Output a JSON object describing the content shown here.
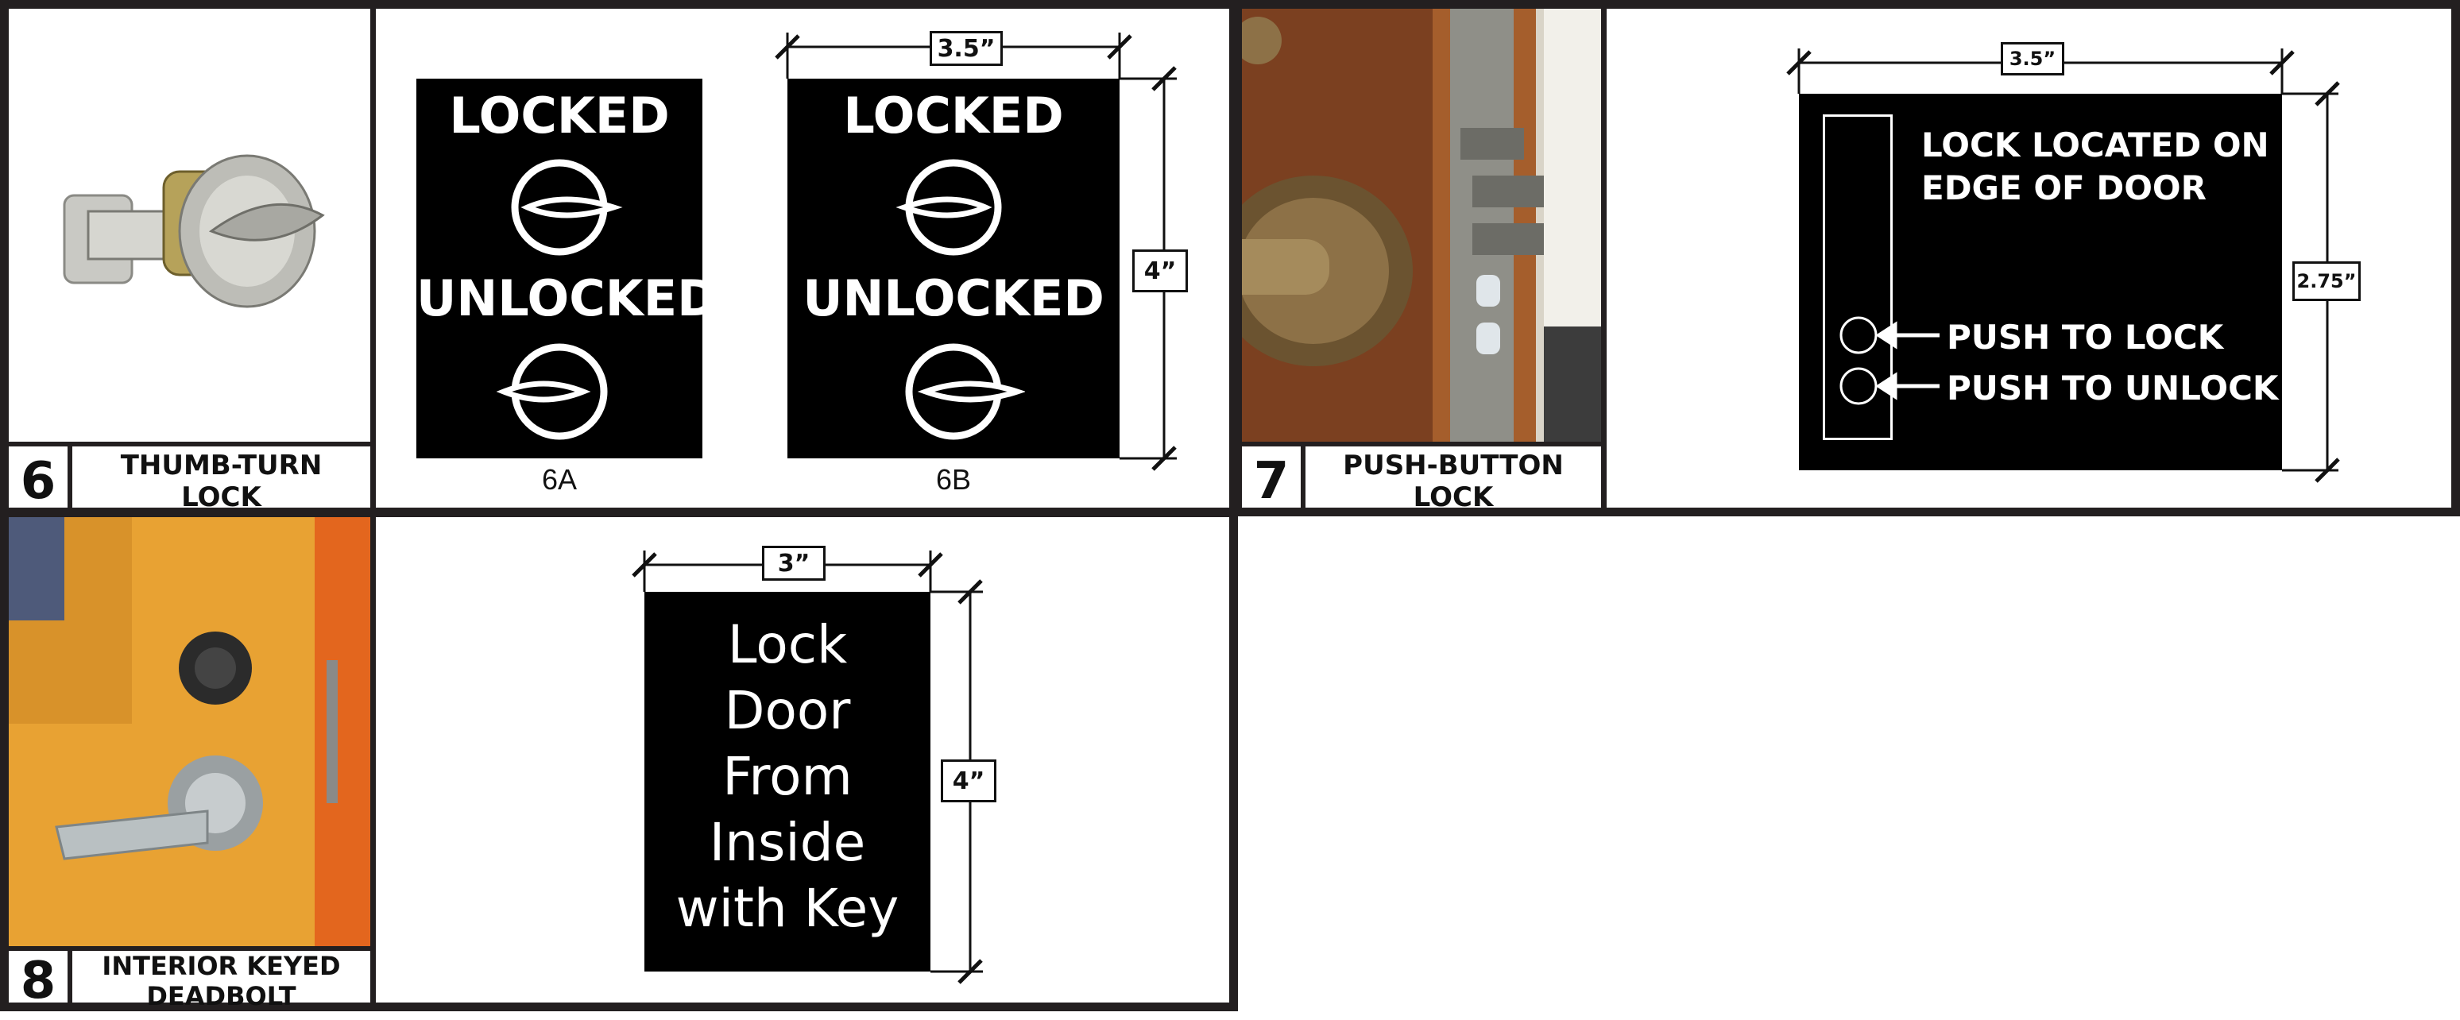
{
  "panel6": {
    "number": "6",
    "caption": "THUMB-TURN\nLOCK",
    "sign_a": {
      "locked": "LOCKED",
      "unlocked": "UNLOCKED",
      "label": "6A"
    },
    "sign_b": {
      "locked": "LOCKED",
      "unlocked": "UNLOCKED",
      "label": "6B"
    },
    "dim_width": "3.5”",
    "dim_height": "4”"
  },
  "panel7": {
    "number": "7",
    "caption": "PUSH-BUTTON\nLOCK",
    "sign_title_1": "LOCK LOCATED ON",
    "sign_title_2": "EDGE OF DOOR",
    "push_lock": "PUSH TO LOCK",
    "push_unlock": "PUSH TO UNLOCK",
    "dim_width": "3.5”",
    "dim_height": "2.75”"
  },
  "panel8": {
    "number": "8",
    "caption": "INTERIOR KEYED\nDEADBOLT",
    "sign_lines": [
      "Lock",
      "Door",
      "From",
      "Inside",
      "with Key"
    ],
    "dim_width": "3”",
    "dim_height": "4”"
  },
  "colors": {
    "border": "#231f20",
    "sign": "#000000",
    "door_orange": "#e8a233",
    "wood": "#8a4a24"
  }
}
